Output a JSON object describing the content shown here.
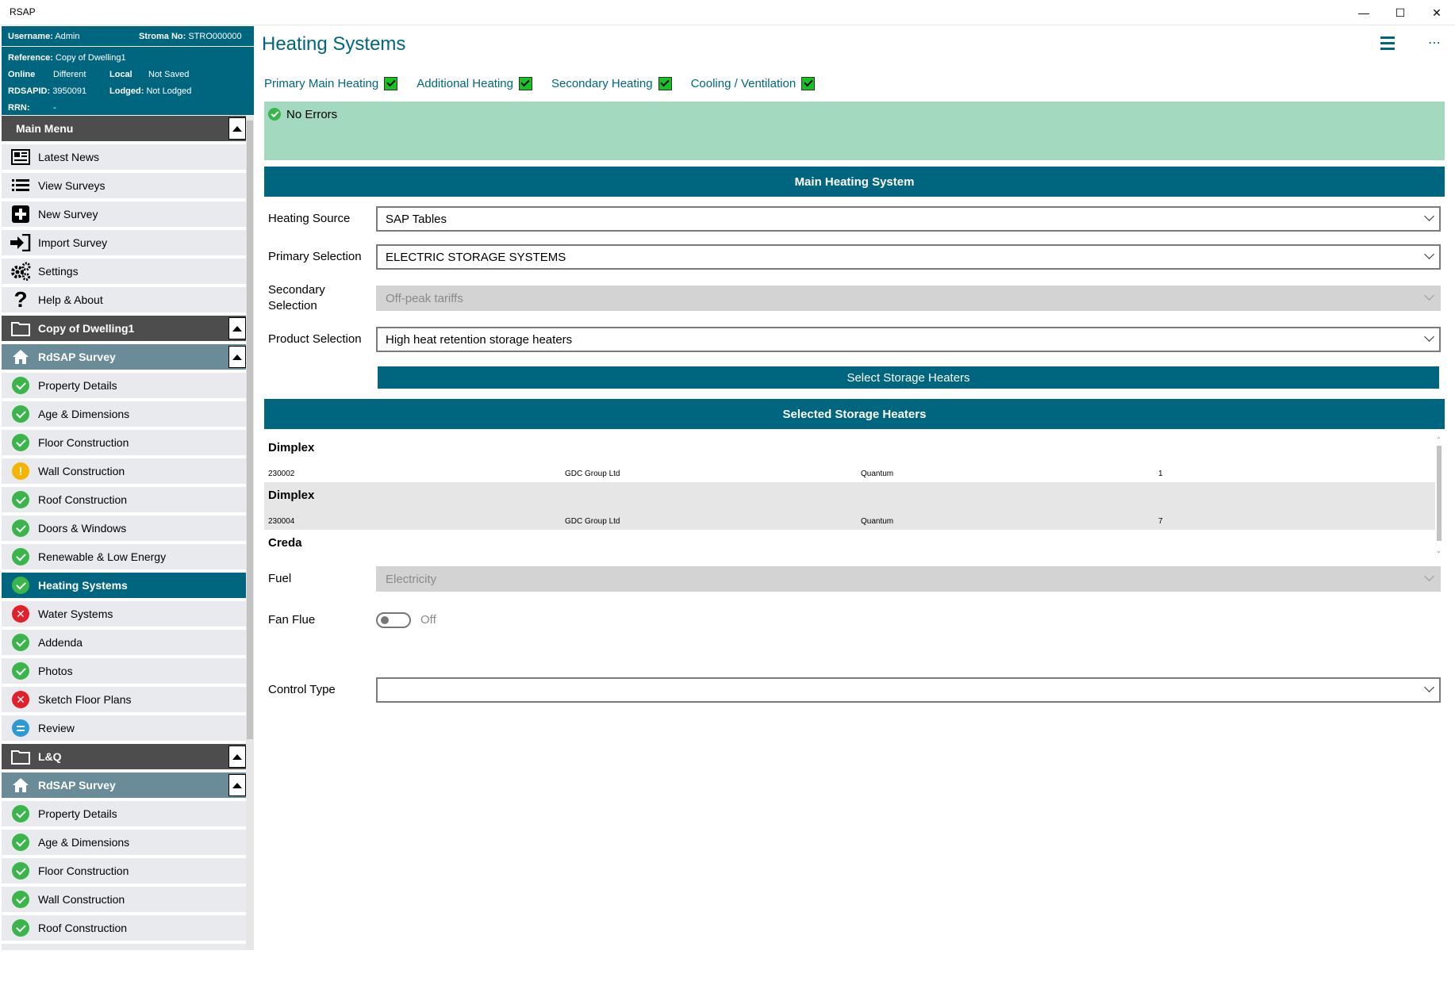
{
  "window": {
    "title": "RSAP"
  },
  "info": {
    "username_label": "Username:",
    "username": "Admin",
    "stroma_label": "Stroma No:",
    "stroma": "STRO000000",
    "reference_label": "Reference:",
    "reference": "Copy of Dwelling1",
    "online_label": "Online",
    "online": "Different",
    "local_label": "Local",
    "local": "Not Saved",
    "rdsapid_label": "RDSAPID:",
    "rdsapid": "3950091",
    "lodged_label": "Lodged:",
    "lodged": "Not Lodged",
    "rrn_label": "RRN:",
    "rrn": "-"
  },
  "menu": {
    "main_menu": "Main Menu",
    "items": [
      {
        "label": "Latest News",
        "icon": "news-icon"
      },
      {
        "label": "View Surveys",
        "icon": "list-icon"
      },
      {
        "label": "New Survey",
        "icon": "plus-icon"
      },
      {
        "label": "Import Survey",
        "icon": "import-icon"
      },
      {
        "label": "Settings",
        "icon": "gear-icon"
      },
      {
        "label": "Help & About",
        "icon": "question-icon"
      }
    ],
    "dwelling1": "Copy of Dwelling1",
    "survey1": "RdSAP Survey",
    "survey1_items": [
      {
        "label": "Property Details",
        "status": "ok"
      },
      {
        "label": "Age & Dimensions",
        "status": "ok"
      },
      {
        "label": "Floor Construction",
        "status": "ok"
      },
      {
        "label": "Wall Construction",
        "status": "warning"
      },
      {
        "label": "Roof Construction",
        "status": "ok"
      },
      {
        "label": "Doors & Windows",
        "status": "ok"
      },
      {
        "label": "Renewable & Low Energy",
        "status": "ok"
      },
      {
        "label": "Heating Systems",
        "status": "ok"
      },
      {
        "label": "Water Systems",
        "status": "error"
      },
      {
        "label": "Addenda",
        "status": "ok"
      },
      {
        "label": "Photos",
        "status": "ok"
      },
      {
        "label": "Sketch Floor Plans",
        "status": "error"
      },
      {
        "label": "Review",
        "status": "review"
      }
    ],
    "dwelling2": "L&Q",
    "survey2": "RdSAP Survey",
    "survey2_items": [
      {
        "label": "Property Details",
        "status": "ok"
      },
      {
        "label": "Age & Dimensions",
        "status": "ok"
      },
      {
        "label": "Floor Construction",
        "status": "ok"
      },
      {
        "label": "Wall Construction",
        "status": "ok"
      },
      {
        "label": "Roof Construction",
        "status": "ok"
      }
    ]
  },
  "page": {
    "title": "Heating Systems"
  },
  "tabs": [
    "Primary Main Heating",
    "Additional Heating",
    "Secondary Heating",
    "Cooling / Ventilation"
  ],
  "status": {
    "message": "No Errors"
  },
  "main_heating": {
    "section_title": "Main Heating System",
    "heating_source_label": "Heating Source",
    "heating_source": "SAP Tables",
    "primary_selection_label": "Primary Selection",
    "primary_selection": "ELECTRIC STORAGE SYSTEMS",
    "secondary_selection_label": "Secondary Selection",
    "secondary_selection": "Off-peak tariffs",
    "product_selection_label": "Product Selection",
    "product_selection": "High heat retention storage heaters",
    "select_button": "Select Storage Heaters"
  },
  "storage_heaters": {
    "section_title": "Selected Storage Heaters",
    "items": [
      {
        "brand": "Dimplex",
        "code": "230002",
        "manufacturer": "GDC Group Ltd",
        "model": "Quantum",
        "qty": "1"
      },
      {
        "brand": "Dimplex",
        "code": "230004",
        "manufacturer": "GDC Group Ltd",
        "model": "Quantum",
        "qty": "7"
      },
      {
        "brand": "Creda",
        "code": "",
        "manufacturer": "",
        "model": "",
        "qty": ""
      }
    ]
  },
  "fuel": {
    "label": "Fuel",
    "value": "Electricity"
  },
  "fan_flue": {
    "label": "Fan Flue",
    "state": "Off"
  },
  "control_type": {
    "label": "Control Type",
    "value": ""
  },
  "colors": {
    "accent": "#006680",
    "ok": "#3ab54a",
    "error": "#e0202a",
    "warning": "#f5b400",
    "info_bar": "#a3d9bf"
  }
}
